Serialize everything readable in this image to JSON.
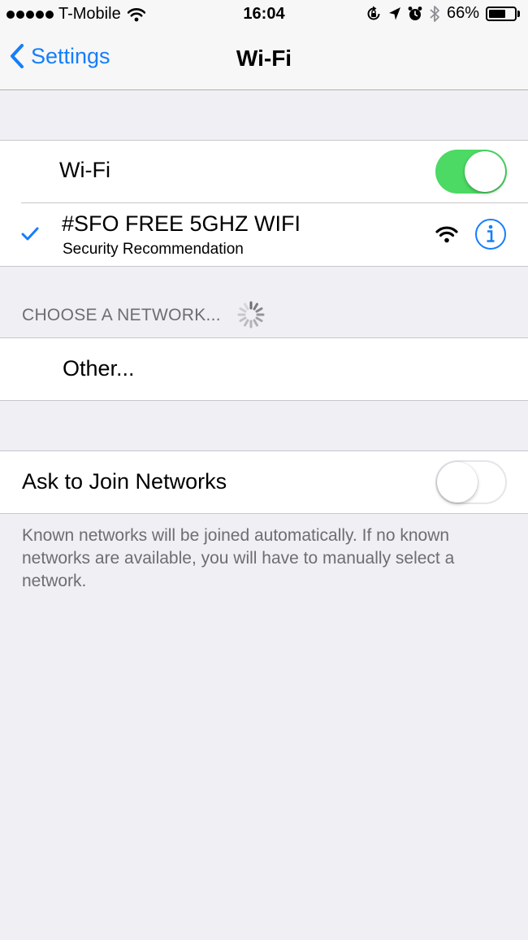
{
  "status_bar": {
    "carrier": "T-Mobile",
    "time": "16:04",
    "battery_percent": "66%",
    "battery_level": 0.66,
    "signal_dots": 5
  },
  "nav": {
    "back_label": "Settings",
    "title": "Wi-Fi"
  },
  "wifi_toggle": {
    "label": "Wi-Fi",
    "on": true
  },
  "connected_network": {
    "name": "#SFO FREE 5GHZ WIFI",
    "subtitle": "Security Recommendation"
  },
  "choose_network": {
    "header": "CHOOSE A NETWORK...",
    "other_label": "Other..."
  },
  "ask_to_join": {
    "label": "Ask to Join Networks",
    "on": false,
    "footer": "Known networks will be joined automatically. If no known networks are available, you will have to manually select a network."
  },
  "colors": {
    "accent": "#157efb",
    "toggle_on": "#4cd964",
    "background": "#efeff4",
    "secondary_text": "#6d6d72"
  },
  "icons": [
    "wifi-icon",
    "orientation-lock-icon",
    "location-icon",
    "alarm-icon",
    "bluetooth-icon",
    "battery-icon",
    "chevron-left-icon",
    "checkmark-icon",
    "wifi-signal-icon",
    "info-icon",
    "spinner-icon"
  ]
}
